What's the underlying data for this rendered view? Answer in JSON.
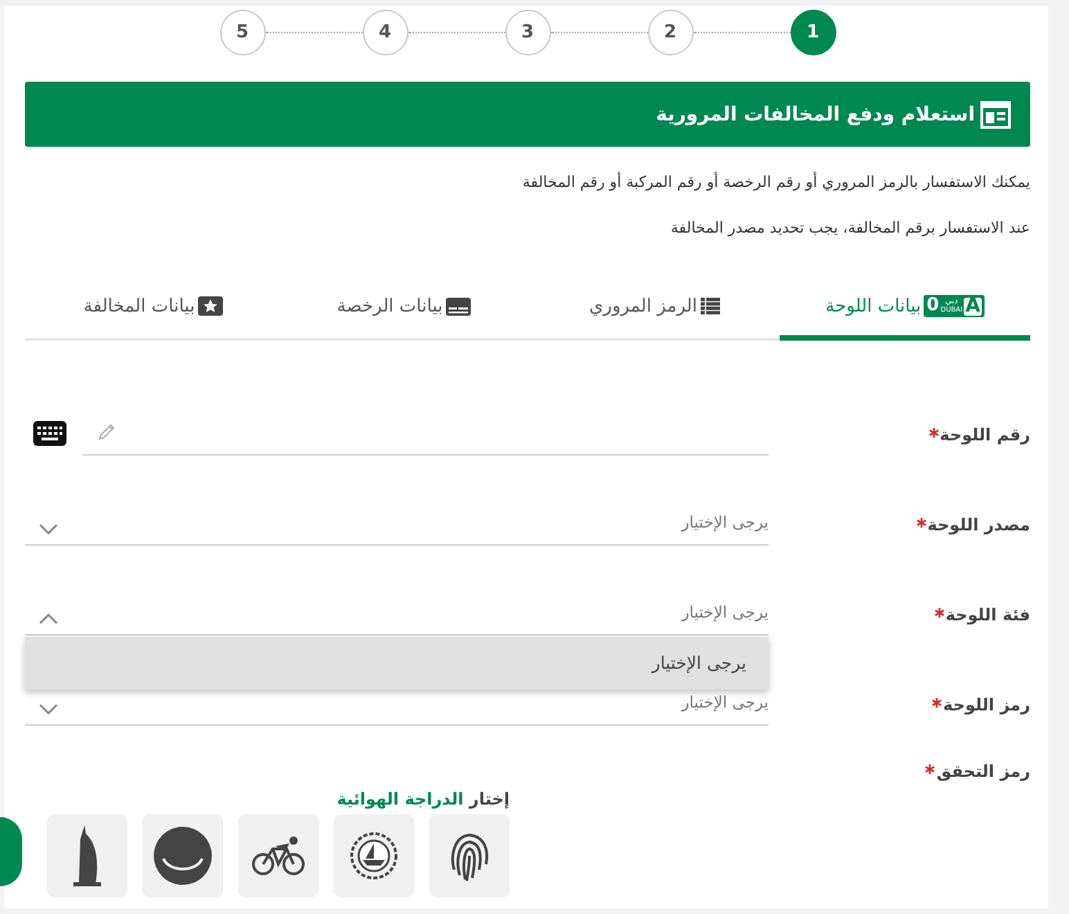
{
  "steps": [
    {
      "label": "1",
      "selected": true
    },
    {
      "label": "2",
      "selected": false
    },
    {
      "label": "3",
      "selected": false
    },
    {
      "label": "4",
      "selected": false
    },
    {
      "label": "5",
      "selected": false
    }
  ],
  "header": {
    "title": "استعلام ودفع المخالفات المرورية"
  },
  "notes": [
    "يمكنك الاستفسار بالرمز المروري أو رقم الرخصة أو رقم المركبة أو رقم المخالفة",
    "عند الاستفسار برقم المخالفة، يجب تحديد مصدر المخالفة"
  ],
  "tabs": [
    {
      "label": "بيانات اللوحة",
      "selected": true,
      "plate": {
        "number": "0",
        "code": "A",
        "city_ar": "دبي",
        "city_en": "DUBAI"
      }
    },
    {
      "label": "الرمز المروري",
      "selected": false
    },
    {
      "label": "بيانات الرخصة",
      "selected": false
    },
    {
      "label": "بيانات المخالفة",
      "selected": false
    }
  ],
  "fields": [
    {
      "kind": "text",
      "label": "رقم اللوحة",
      "required": true
    },
    {
      "kind": "select",
      "label": "مصدر اللوحة",
      "required": true,
      "placeholder": "يرجى الإختيار",
      "expanded": false
    },
    {
      "kind": "select",
      "label": "فئة اللوحة",
      "required": true,
      "placeholder": "يرجى الإختيار",
      "expanded": true,
      "options": [
        "يرجى الإختيار"
      ]
    },
    {
      "kind": "select",
      "label": "رمز اللوحة",
      "required": true,
      "placeholder": "يرجى الإختيار",
      "expanded": false
    }
  ],
  "captcha": {
    "label": "رمز التحقق",
    "required": true,
    "prompt": "إختار",
    "target": "الدراجة الهوائية"
  }
}
